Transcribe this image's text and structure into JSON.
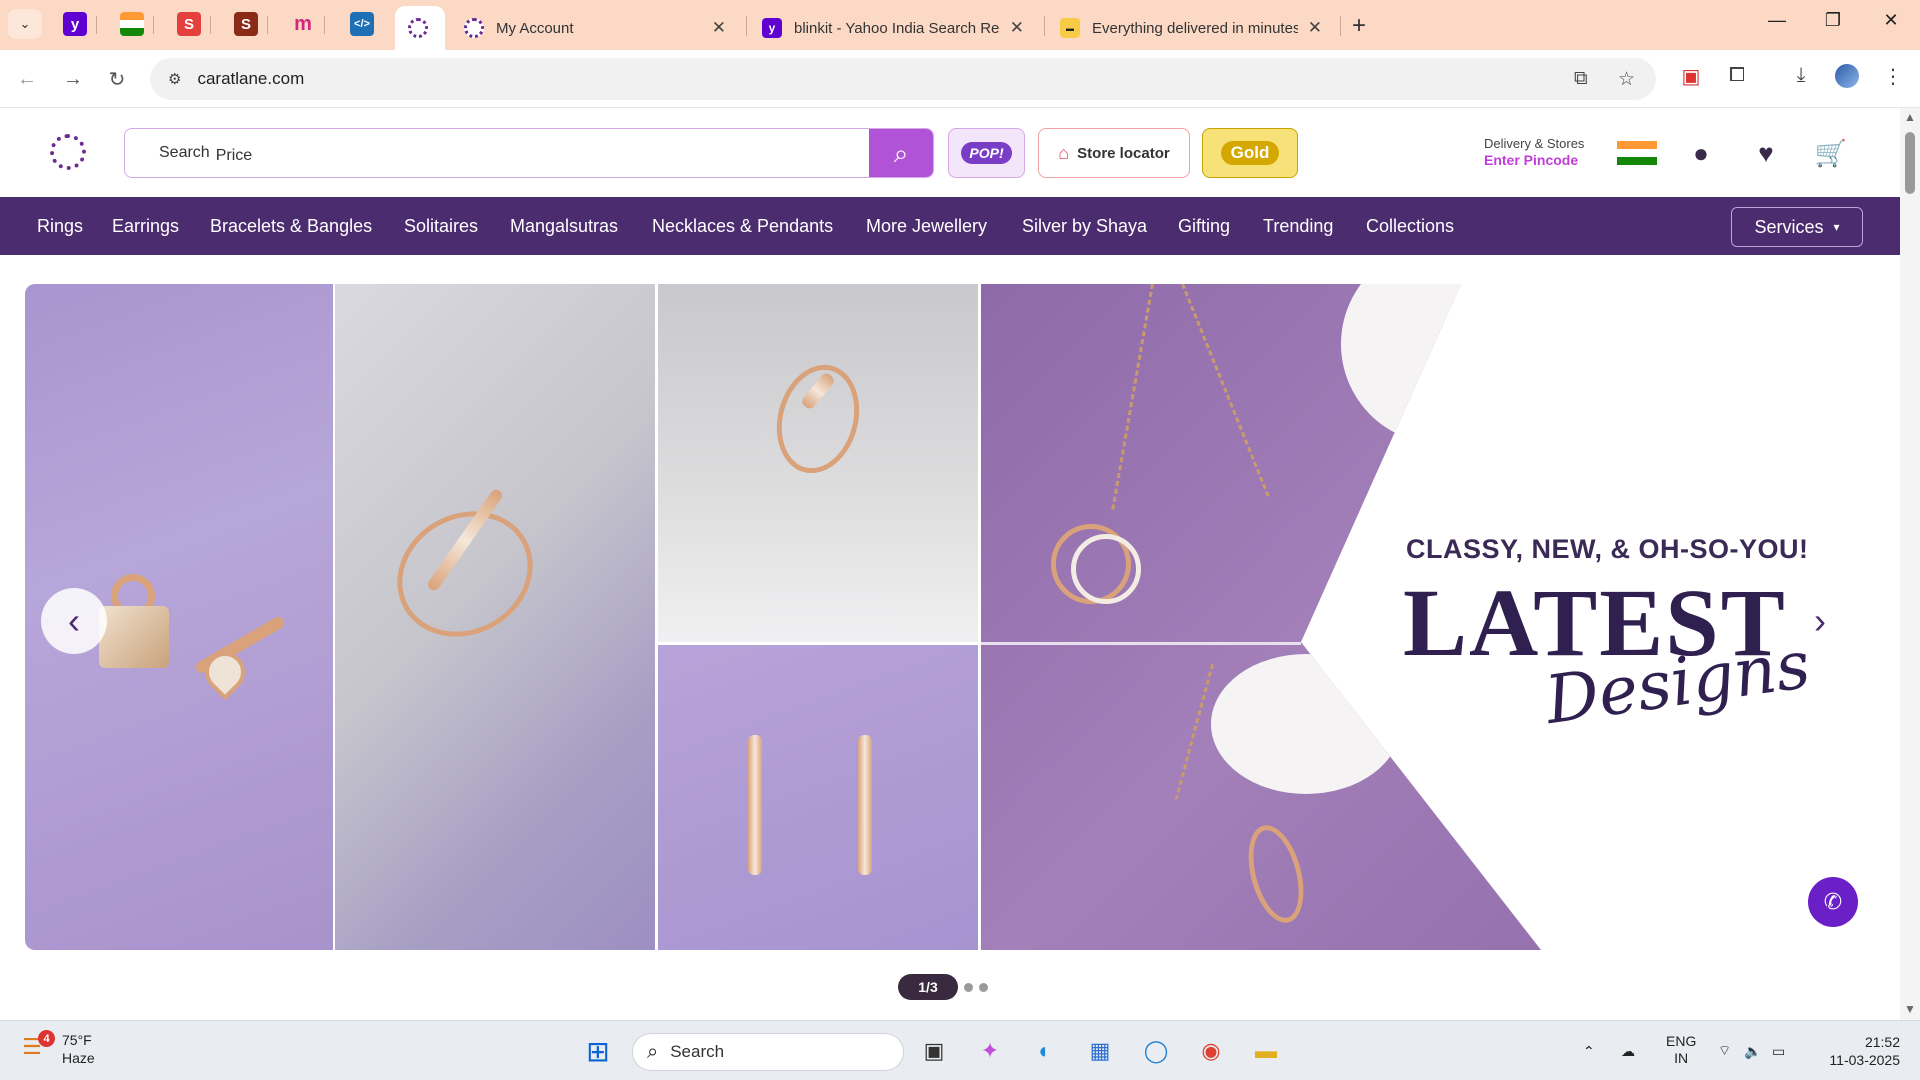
{
  "browser": {
    "tabs": [
      {
        "title": "My Account"
      },
      {
        "title": "blinkit - Yahoo India Search Res"
      },
      {
        "title": "Everything delivered in minutes"
      }
    ],
    "address": "caratlane.com"
  },
  "header": {
    "search_label": "Search",
    "search_placeholder": "Price",
    "pop_label": "POP!",
    "store_locator": "Store locator",
    "gold_label": "Gold",
    "delivery_title": "Delivery & Stores",
    "delivery_action": "Enter Pincode"
  },
  "nav": {
    "items": [
      "Rings",
      "Earrings",
      "Bracelets & Bangles",
      "Solitaires",
      "Mangalsutras",
      "Necklaces & Pendants",
      "More Jewellery",
      "Silver by Shaya",
      "Gifting",
      "Trending",
      "Collections"
    ],
    "services": "Services"
  },
  "banner": {
    "tagline": "CLASSY, NEW, & OH-SO-YOU!",
    "headline": "LATEST",
    "script": "Designs",
    "slide_indicator": "1/3"
  },
  "taskbar": {
    "weather_badge": "4",
    "temperature": "75°F",
    "condition": "Haze",
    "search": "Search",
    "lang1": "ENG",
    "lang2": "IN",
    "time": "21:52",
    "date": "11-03-2025"
  },
  "colors": {
    "brand_purple": "#4b2c6f",
    "search_button": "#b153d6",
    "pincode_pink": "#c13ed8"
  }
}
